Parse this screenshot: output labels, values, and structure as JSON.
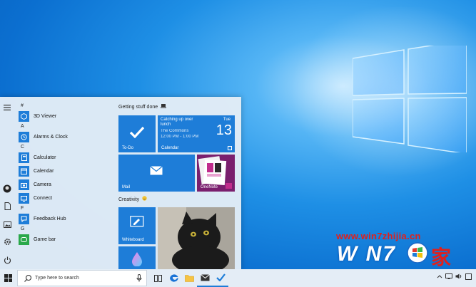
{
  "start_menu": {
    "apps": [
      {
        "letter": "#",
        "label": "3D Viewer",
        "icon": "cube-icon"
      },
      {
        "letter": "A",
        "label": "Alarms & Clock",
        "icon": "clock-icon"
      },
      {
        "letter": "C",
        "label": "Calculator",
        "icon": "calculator-icon"
      },
      {
        "letter": "",
        "label": "Calendar",
        "icon": "calendar-icon"
      },
      {
        "letter": "",
        "label": "Camera",
        "icon": "camera-icon"
      },
      {
        "letter": "",
        "label": "Connect",
        "icon": "connect-icon"
      },
      {
        "letter": "F",
        "label": "Feedback Hub",
        "icon": "feedback-icon"
      },
      {
        "letter": "G",
        "label": "Game bar",
        "icon": "gamebar-icon"
      }
    ],
    "groups": {
      "getting_stuff_done": "Getting stuff done",
      "creativity": "Creativity"
    },
    "tiles": {
      "todo": {
        "label": "To-Do"
      },
      "calendar": {
        "event": "Catching up over lunch",
        "location": "The Commons",
        "time": "12:00 PM - 1:00 PM",
        "weekday": "Tue",
        "day": "13",
        "label": "Calendar"
      },
      "mail": {
        "label": "Mail"
      },
      "onenote": {
        "label": "OneNote"
      },
      "whiteboard": {
        "label": "Whiteboard"
      }
    }
  },
  "taskbar": {
    "search_placeholder": "Type here to search"
  },
  "watermark": {
    "url": "www.win7zhijia.cn",
    "brand": "W N7",
    "brand_suffix": "家"
  }
}
